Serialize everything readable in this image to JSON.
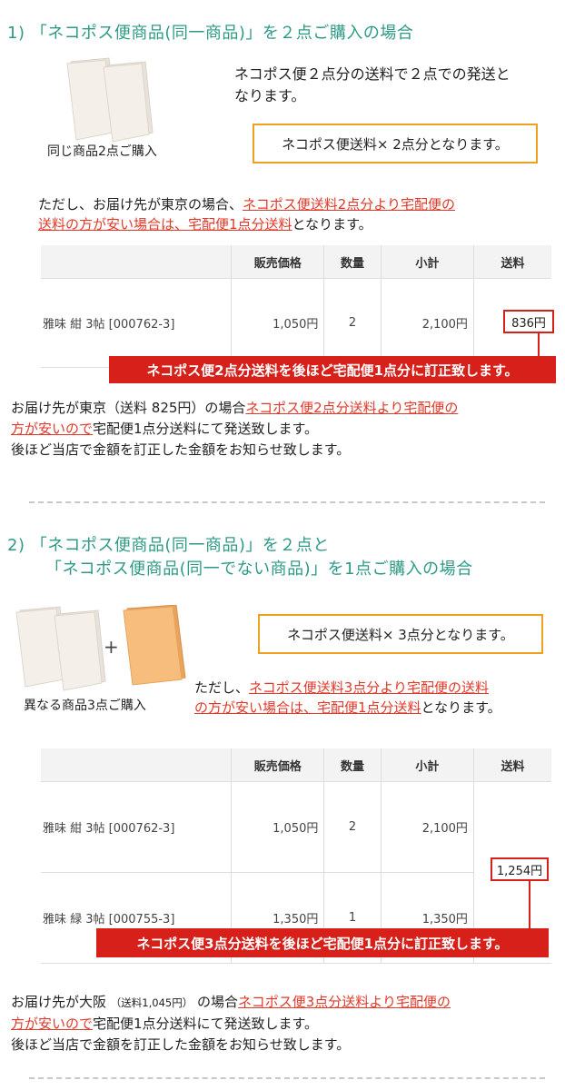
{
  "section1": {
    "heading": "1) 「ネコポス便商品(同一商品)」を２点ご購入の場合",
    "caption": "同じ商品2点ご購入",
    "desc_line1": "ネコポス便２点分の送料で２点での発送と",
    "desc_line2": "なります。",
    "box": "ネコポス便送料× 2点分となります。",
    "note_prefix": "ただし、お届け先が東京の場合、",
    "note_red1": "ネコポス便送料2点分より宅配便の",
    "note_red2": "送料の方が安い場合は、宅配便1点分送料",
    "note_suffix": "となります。",
    "table": {
      "headers": [
        "販売価格",
        "数量",
        "小計",
        "送料"
      ],
      "rows": [
        {
          "name": "雅味 紺 3帖 [000762-3]",
          "price": "1,050円",
          "qty": "2",
          "subtotal": "2,100円"
        }
      ],
      "shipping": "836円"
    },
    "banner": "ネコポス便2点分送料を後ほど宅配便1点分に訂正致します。",
    "footer_prefix": "お届け先が東京（送料 825円）の場合",
    "footer_red1": "ネコポス便2点分送料より宅配便の",
    "footer_red2": "方が安いので",
    "footer_after": "宅配便1点分送料にて発送致します。",
    "footer_line3": "後ほど当店で金額を訂正した金額をお知らせ致します。"
  },
  "section2": {
    "heading_line1": "2) 「ネコポス便商品(同一商品)」を２点と",
    "heading_line2": "「ネコポス便商品(同一でない商品)」を1点ご購入の場合",
    "plus": "+",
    "caption": "異なる商品3点ご購入",
    "box": "ネコポス便送料× 3点分となります。",
    "note_prefix": "ただし、",
    "note_red1": "ネコポス便送料3点分より宅配便の送料",
    "note_red2": "の方が安い場合は、宅配便1点分送料",
    "note_suffix": "となります。",
    "table": {
      "headers": [
        "販売価格",
        "数量",
        "小計",
        "送料"
      ],
      "rows": [
        {
          "name": "雅味 紺 3帖 [000762-3]",
          "price": "1,050円",
          "qty": "2",
          "subtotal": "2,100円"
        },
        {
          "name": "雅味 緑 3帖 [000755-3]",
          "price": "1,350円",
          "qty": "1",
          "subtotal": "1,350円"
        }
      ],
      "shipping": "1,254円"
    },
    "banner": "ネコポス便3点分送料を後ほど宅配便1点分に訂正致します。",
    "footer_prefix": "お届け先が大阪",
    "footer_small": "（送料1,045円）",
    "footer_mid": "の場合",
    "footer_red1": "ネコポス便3点分送料より宅配便の",
    "footer_red2": "方が安いので",
    "footer_after": "宅配便1点分送料にて発送致します。",
    "footer_line3": "後ほど当店で金額を訂正した金額をお知らせ致します。"
  },
  "colors": {
    "heading": "#2e9a86",
    "accent_red": "#d8201a",
    "box_orange": "#f0a020",
    "package_white": "#f2ede6",
    "package_orange": "#f4b46a"
  }
}
